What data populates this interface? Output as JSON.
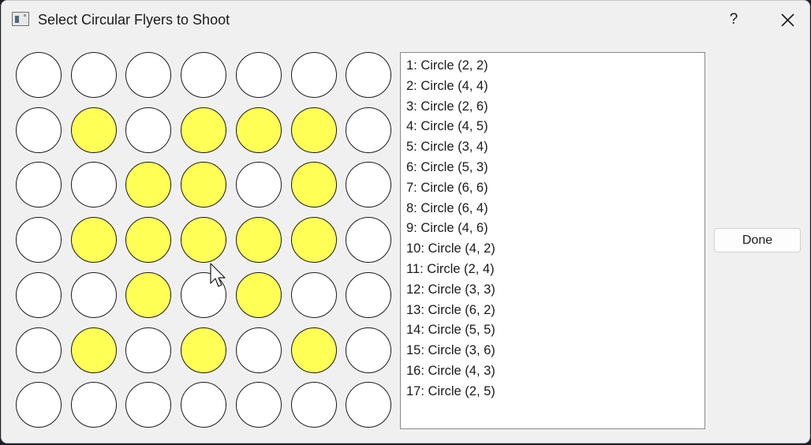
{
  "window": {
    "title": "Select Circular Flyers to Shoot",
    "help_label": "?"
  },
  "grid": {
    "rows": 7,
    "cols": 7,
    "highlight_color": "#ffff55",
    "empty_color": "#ffffff",
    "highlighted_cells": [
      [
        1,
        1
      ],
      [
        1,
        3
      ],
      [
        1,
        4
      ],
      [
        1,
        5
      ],
      [
        2,
        2
      ],
      [
        2,
        3
      ],
      [
        2,
        5
      ],
      [
        3,
        1
      ],
      [
        3,
        2
      ],
      [
        3,
        3
      ],
      [
        3,
        4
      ],
      [
        3,
        5
      ],
      [
        4,
        2
      ],
      [
        4,
        4
      ],
      [
        5,
        1
      ],
      [
        5,
        3
      ],
      [
        5,
        5
      ]
    ]
  },
  "list": {
    "items": [
      "1: Circle (2, 2)",
      "2: Circle (4, 4)",
      "3: Circle (2, 6)",
      "4: Circle (4, 5)",
      "5: Circle (3, 4)",
      "6: Circle (5, 3)",
      "7: Circle (6, 6)",
      "8: Circle (6, 4)",
      "9: Circle (4, 6)",
      "10: Circle (4, 2)",
      "11: Circle (2, 4)",
      "12: Circle (3, 3)",
      "13: Circle (6, 2)",
      "14: Circle (5, 5)",
      "15: Circle (3, 6)",
      "16: Circle (4, 3)",
      "17: Circle (2, 5)"
    ]
  },
  "buttons": {
    "done_label": "Done"
  }
}
